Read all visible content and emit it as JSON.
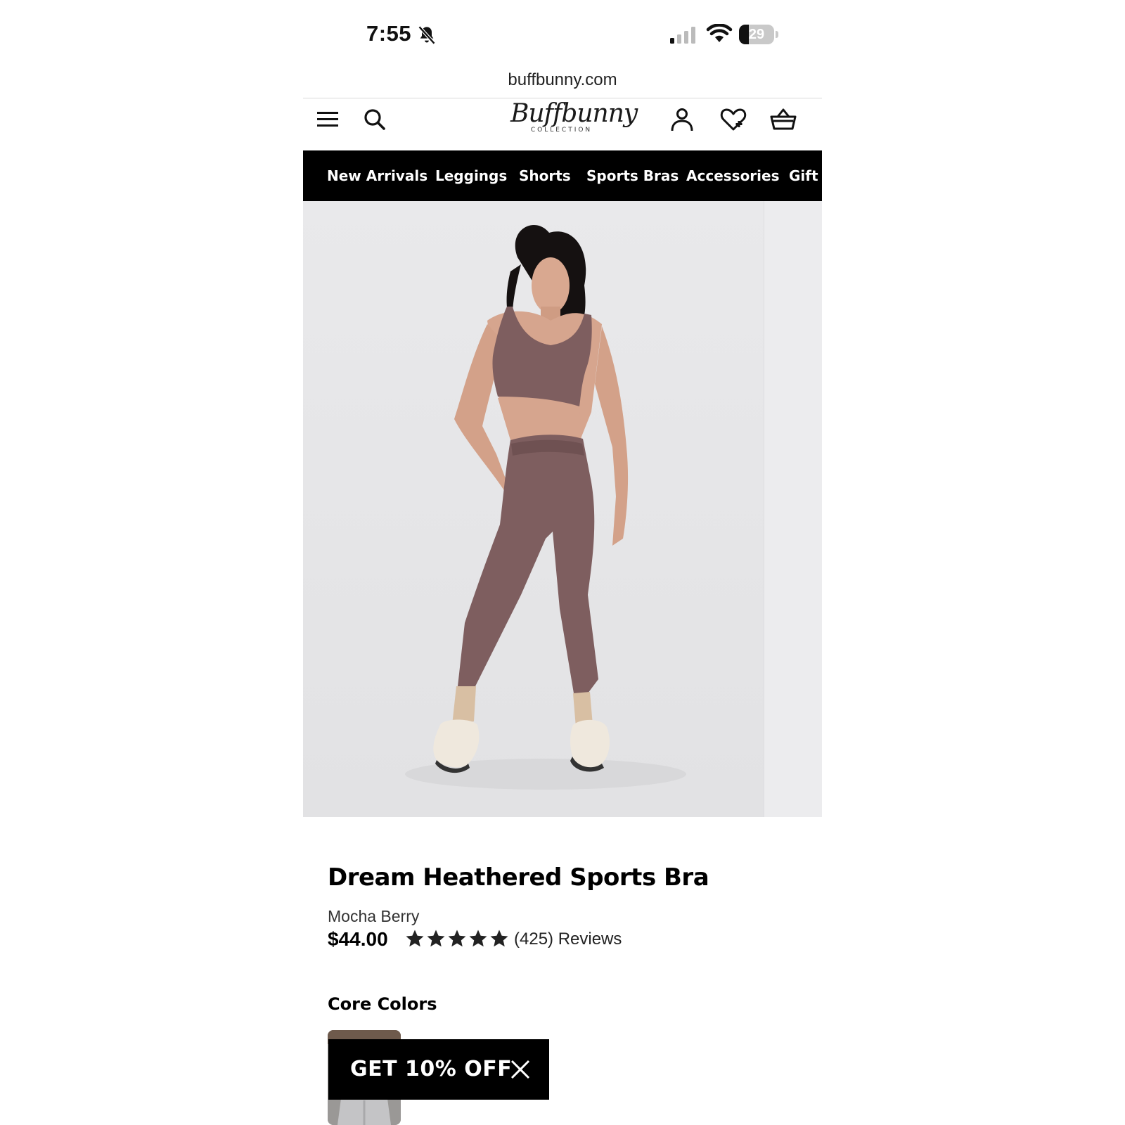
{
  "status_bar": {
    "time": "7:55",
    "battery": "29",
    "battery_level": 0.29,
    "icons": [
      "bell-slash-icon",
      "cellular-signal-icon",
      "wifi-icon",
      "battery-icon"
    ]
  },
  "browser": {
    "url": "buffbunny.com"
  },
  "header": {
    "logo_text": "Buffbunny",
    "logo_subtext": "COLLECTION",
    "icons": [
      "menu-icon",
      "search-icon",
      "account-icon",
      "wishlist-icon",
      "cart-icon"
    ]
  },
  "nav": {
    "items": [
      "New Arrivals",
      "Leggings",
      "Shorts",
      "Sports Bras",
      "Accessories",
      "Gift C"
    ]
  },
  "product": {
    "title": "Dream Heathered Sports Bra",
    "color": "Mocha Berry",
    "price": "$44.00",
    "rating": 5,
    "reviews": "(425) Reviews"
  },
  "colors_section": {
    "heading": "Core Colors"
  },
  "promo": {
    "label": "GET 10% OFF"
  },
  "theme": {
    "nav_bg": "#000000",
    "garment": "#7e5e5f",
    "skin": "#d6a58e",
    "hair": "#151111",
    "hero_bg": "#e6e6e8"
  }
}
